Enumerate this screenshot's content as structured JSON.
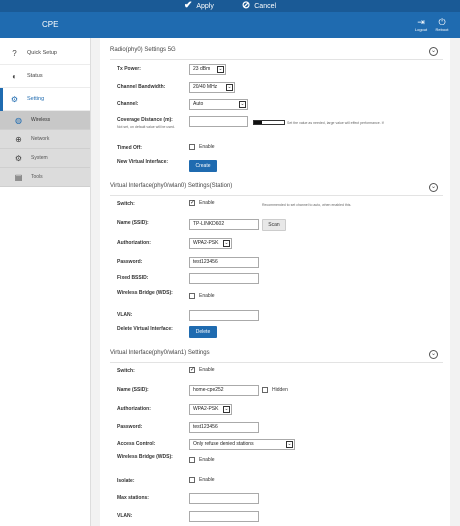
{
  "topbar": {
    "apply_icon": "check-icon",
    "apply": "Apply",
    "cancel_icon": "cancel-icon",
    "cancel": "Cancel"
  },
  "header": {
    "title": "CPE",
    "logout": "Logout",
    "reboot": "Reboot"
  },
  "sidebar": {
    "items": [
      {
        "label": "Quick Setup",
        "icon": "question-icon"
      },
      {
        "label": "Status",
        "icon": "status-icon"
      },
      {
        "label": "Setting",
        "icon": "gear-icon"
      }
    ],
    "subitems": [
      {
        "label": "Wireless",
        "icon": "wireless-icon"
      },
      {
        "label": "Network",
        "icon": "globe-icon"
      },
      {
        "label": "System",
        "icon": "gear-icon"
      },
      {
        "label": "Tools",
        "icon": "toolbox-icon"
      }
    ]
  },
  "radio": {
    "title": "Radio(phy0) Settings 5G",
    "tx_power_label": "Tx Power:",
    "tx_power": "23 dBm",
    "bandwidth_label": "Channel Bandwidth:",
    "bandwidth": "20/40 MHz",
    "channel_label": "Channel:",
    "channel": "Auto",
    "coverage_label": "Coverage Distance (m):",
    "coverage_note": "Not set, on default value will be used.",
    "coverage_value": "",
    "coverage_level": 0.25,
    "coverage_hint": "Set the value as needed, large value will effect performance. If",
    "timed_off_label": "Timed Off:",
    "timed_off": "Enable",
    "new_vif_label": "New Virtual Interface:",
    "create": "Create"
  },
  "vif0": {
    "title": "Virtual Interface(phy0/wlan0) Settings(Station)",
    "switch_label": "Switch:",
    "switch": "Enable",
    "switch_hint": "Recommended to set channel to auto, when enabled this.",
    "ssid_label": "Name (SSID):",
    "ssid": "TP-LINKD602",
    "scan": "Scan",
    "auth_label": "Authorization:",
    "auth": "WPA2-PSK",
    "password_label": "Password:",
    "password": "test123456",
    "bssid_label": "Fixed BSSID:",
    "bssid": "",
    "wds_label": "Wireless Bridge (WDS):",
    "wds": "Enable",
    "vlan_label": "VLAN:",
    "vlan": "",
    "delete_label": "Delete Virtual Interface:",
    "delete": "Delete"
  },
  "vif1": {
    "title": "Virtual Interface(phy0/wlan1) Settings",
    "switch_label": "Switch:",
    "switch": "Enable",
    "ssid_label": "Name (SSID):",
    "ssid": "home-cpe252",
    "hidden": "Hidden",
    "auth_label": "Authorization:",
    "auth": "WPA2-PSK",
    "password_label": "Password:",
    "password": "test123456",
    "access_label": "Access Control:",
    "access": "Only refuse denied stations",
    "wds_label": "Wireless Bridge (WDS):",
    "wds": "Enable",
    "isolate_label": "Isolate:",
    "isolate": "Enable",
    "max_label": "Max stations:",
    "max": "",
    "vlan_label": "VLAN:",
    "vlan": ""
  },
  "colors": {
    "topbar": "#1a5a96",
    "header": "#1f6bb0",
    "accent": "#1f6bb0"
  }
}
